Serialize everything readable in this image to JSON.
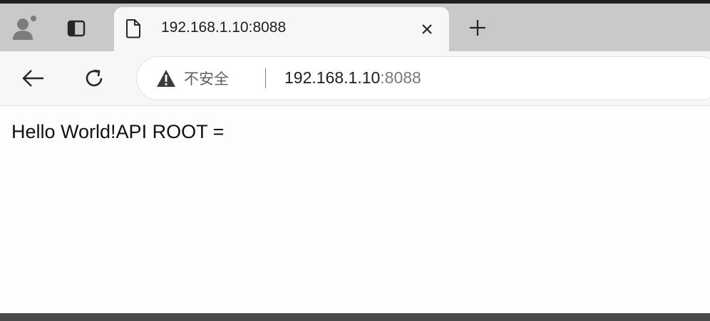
{
  "colors": {
    "tab_strip_background": "#c9c9c9",
    "active_tab_background": "#f7f7f7",
    "toolbar_background": "#f7f7f7",
    "page_background": "#fdfdfd",
    "warning_icon": "#3c3c3c"
  },
  "tab_strip": {
    "profile_icon": "profile-avatar-icon",
    "vertical_tabs_icon": "vertical-tabs-icon",
    "active_tab": {
      "icon": "page-icon",
      "title": "192.168.1.10:8088",
      "close_icon": "close-icon"
    },
    "new_tab_icon": "plus-icon"
  },
  "toolbar": {
    "back_icon": "back-arrow-icon",
    "reload_icon": "reload-icon",
    "address_bar": {
      "security_icon": "warning-triangle-icon",
      "security_label": "不安全",
      "url_host": "192.168.1.10",
      "url_port": ":8088"
    }
  },
  "page": {
    "body_text": "Hello World!API ROOT ="
  }
}
